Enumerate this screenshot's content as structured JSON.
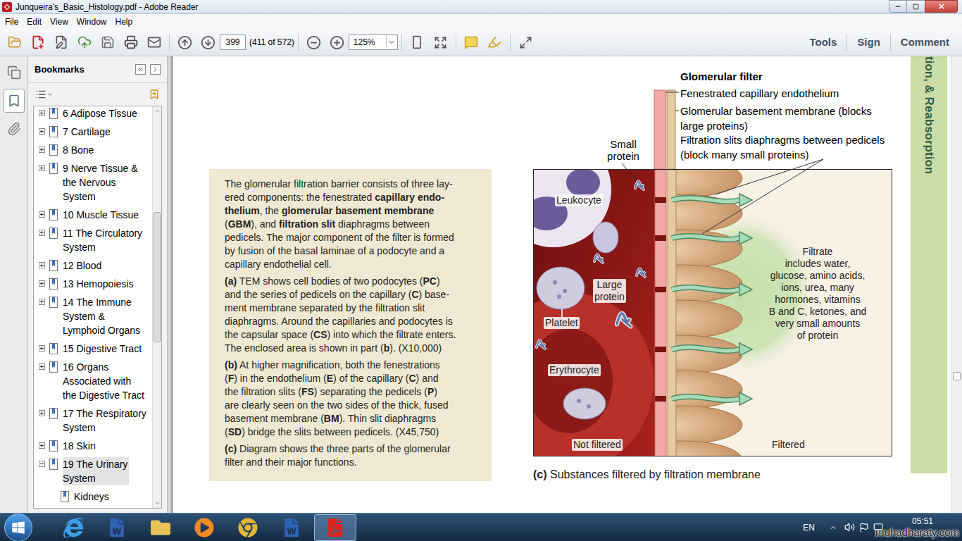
{
  "window": {
    "title": "Junqueira's_Basic_Histology.pdf - Adobe Reader"
  },
  "menu": [
    "File",
    "Edit",
    "View",
    "Window",
    "Help"
  ],
  "toolbar": {
    "page": "399",
    "page_count": "(411 of 572)",
    "zoom": "125%",
    "panes": [
      "Tools",
      "Sign",
      "Comment"
    ]
  },
  "nav_strip": [
    {
      "kind": "pages",
      "selected": false
    },
    {
      "kind": "bookmarks",
      "selected": true
    },
    {
      "kind": "attachments",
      "selected": false
    }
  ],
  "bookmarks": {
    "title": "Bookmarks",
    "items": [
      {
        "lines": [
          "6 Adipose Tissue"
        ],
        "depth": 0,
        "has_children": true,
        "expanded": false,
        "selected": false
      },
      {
        "lines": [
          "7 Cartilage"
        ],
        "depth": 0,
        "has_children": true,
        "expanded": false,
        "selected": false
      },
      {
        "lines": [
          "8 Bone"
        ],
        "depth": 0,
        "has_children": true,
        "expanded": false,
        "selected": false
      },
      {
        "lines": [
          "9 Nerve Tissue &",
          "the Nervous",
          "System"
        ],
        "depth": 0,
        "has_children": true,
        "expanded": false,
        "selected": false
      },
      {
        "lines": [
          "10 Muscle Tissue"
        ],
        "depth": 0,
        "has_children": true,
        "expanded": false,
        "selected": false
      },
      {
        "lines": [
          "11 The Circulatory",
          "System"
        ],
        "depth": 0,
        "has_children": true,
        "expanded": false,
        "selected": false
      },
      {
        "lines": [
          "12 Blood"
        ],
        "depth": 0,
        "has_children": true,
        "expanded": false,
        "selected": false
      },
      {
        "lines": [
          "13 Hemopoiesis"
        ],
        "depth": 0,
        "has_children": true,
        "expanded": false,
        "selected": false
      },
      {
        "lines": [
          "14 The Immune",
          "System &",
          "Lymphoid Organs"
        ],
        "depth": 0,
        "has_children": true,
        "expanded": false,
        "selected": false
      },
      {
        "lines": [
          "15 Digestive Tract"
        ],
        "depth": 0,
        "has_children": true,
        "expanded": false,
        "selected": false
      },
      {
        "lines": [
          "16 Organs",
          "Associated with",
          "the Digestive Tract"
        ],
        "depth": 0,
        "has_children": true,
        "expanded": false,
        "selected": false
      },
      {
        "lines": [
          "17 The Respiratory",
          "System"
        ],
        "depth": 0,
        "has_children": true,
        "expanded": false,
        "selected": false
      },
      {
        "lines": [
          "18 Skin"
        ],
        "depth": 0,
        "has_children": true,
        "expanded": false,
        "selected": false
      },
      {
        "lines": [
          "19 The Urinary",
          "System"
        ],
        "depth": 0,
        "has_children": true,
        "expanded": true,
        "selected": true
      },
      {
        "lines": [
          "Kidneys"
        ],
        "depth": 1,
        "has_children": false,
        "expanded": false,
        "selected": false
      }
    ]
  },
  "document": {
    "caption": [
      [
        [
          {
            "text": "The glomerular filtration barrier consists of three lay-",
            "bold": false
          }
        ],
        [
          {
            "text": "ered components: the fenestrated ",
            "bold": false
          },
          {
            "text": "capillary endo-",
            "bold": true
          }
        ],
        [
          {
            "text": "thelium",
            "bold": true
          },
          {
            "text": ", the ",
            "bold": false
          },
          {
            "text": "glomerular basement membrane",
            "bold": true
          }
        ],
        [
          {
            "text": "(",
            "bold": false
          },
          {
            "text": "GBM",
            "bold": true
          },
          {
            "text": "), and ",
            "bold": false
          },
          {
            "text": "filtration slit",
            "bold": true
          },
          {
            "text": " diaphragms between",
            "bold": false
          }
        ],
        [
          {
            "text": "pedicels. The major component of the filter is formed",
            "bold": false
          }
        ],
        [
          {
            "text": "by fusion of the basal laminae of a podocyte and a",
            "bold": false
          }
        ],
        [
          {
            "text": "capillary endothelial cell.",
            "bold": false
          }
        ]
      ],
      [
        [
          {
            "text": "(a)",
            "bold": true
          },
          {
            "text": " TEM shows cell bodies of two podocytes (",
            "bold": false
          },
          {
            "text": "PC",
            "bold": true
          },
          {
            "text": ")",
            "bold": false
          }
        ],
        [
          {
            "text": "and the series of pedicels on the capillary (",
            "bold": false
          },
          {
            "text": "C",
            "bold": true
          },
          {
            "text": ") base-",
            "bold": false
          }
        ],
        [
          {
            "text": "ment membrane separated by the filtration slit",
            "bold": false
          }
        ],
        [
          {
            "text": "diaphragms. Around the capillaries and podocytes is",
            "bold": false
          }
        ],
        [
          {
            "text": "the capsular space (",
            "bold": false
          },
          {
            "text": "CS",
            "bold": true
          },
          {
            "text": ") into which the filtrate enters.",
            "bold": false
          }
        ],
        [
          {
            "text": "The enclosed area is shown in part (",
            "bold": false
          },
          {
            "text": "b",
            "bold": true
          },
          {
            "text": "). (X10,000)",
            "bold": false
          }
        ]
      ],
      [
        [
          {
            "text": "(b)",
            "bold": true
          },
          {
            "text": " At higher magnification, both the fenestrations",
            "bold": false
          }
        ],
        [
          {
            "text": "(",
            "bold": false
          },
          {
            "text": "F",
            "bold": true
          },
          {
            "text": ") in the endothelium (",
            "bold": false
          },
          {
            "text": "E",
            "bold": true
          },
          {
            "text": ") of the capillary (",
            "bold": false
          },
          {
            "text": "C",
            "bold": true
          },
          {
            "text": ") and",
            "bold": false
          }
        ],
        [
          {
            "text": "the filtration slits (",
            "bold": false
          },
          {
            "text": "FS",
            "bold": true
          },
          {
            "text": ") separating the pedicels (",
            "bold": false
          },
          {
            "text": "P",
            "bold": true
          },
          {
            "text": ")",
            "bold": false
          }
        ],
        [
          {
            "text": "are clearly seen on the two sides of the thick, fused",
            "bold": false
          }
        ],
        [
          {
            "text": "basement membrane (",
            "bold": false
          },
          {
            "text": "BM",
            "bold": true
          },
          {
            "text": "). Thin slit diaphragms",
            "bold": false
          }
        ],
        [
          {
            "text": "(",
            "bold": false
          },
          {
            "text": "SD",
            "bold": true
          },
          {
            "text": ") bridge the slits between pedicels. (X45,750)",
            "bold": false
          }
        ]
      ],
      [
        [
          {
            "text": "(c)",
            "bold": true
          },
          {
            "text": " Diagram shows the three parts of the glomerular",
            "bold": false
          }
        ],
        [
          {
            "text": "filter and their major functions.",
            "bold": false
          }
        ]
      ]
    ],
    "figure": {
      "heading": "Glomerular filter",
      "endothelium": "Fenestrated capillary endothelium",
      "basement": [
        "Glomerular basement membrane (blocks",
        "large proteins)"
      ],
      "slits": [
        "Filtration slits diaphragms between pedicels",
        "(block many small proteins)"
      ],
      "small_protein": [
        "Small",
        "protein"
      ],
      "leukocyte": "Leukocyte",
      "large_protein": [
        "Large",
        "protein"
      ],
      "platelet": "Platelet",
      "erythrocyte": "Erythrocyte",
      "not_filtered": "Not filtered",
      "filtered": "Filtered",
      "filtrate": [
        "Filtrate",
        "includes water,",
        "glucose, amino acids,",
        "ions, urea, many",
        "hormones, vitamins",
        "B and C, ketones, and",
        "very small amounts",
        "of protein"
      ],
      "caption": [
        {
          "text": "(c)",
          "bold": true
        },
        {
          "text": " Substances filtered by filtration membrane",
          "bold": false
        }
      ]
    },
    "side_tab": "tion, & Reabsorption"
  },
  "taskbar": {
    "apps": [
      {
        "kind": "ie",
        "active": false
      },
      {
        "kind": "word",
        "active": false
      },
      {
        "kind": "explorer",
        "active": false
      },
      {
        "kind": "media",
        "active": false
      },
      {
        "kind": "chrome",
        "active": false
      },
      {
        "kind": "word",
        "active": false
      },
      {
        "kind": "acrobat",
        "active": true
      }
    ],
    "language": "EN",
    "time": "05:51",
    "watermark": "muhadharaty.com"
  }
}
